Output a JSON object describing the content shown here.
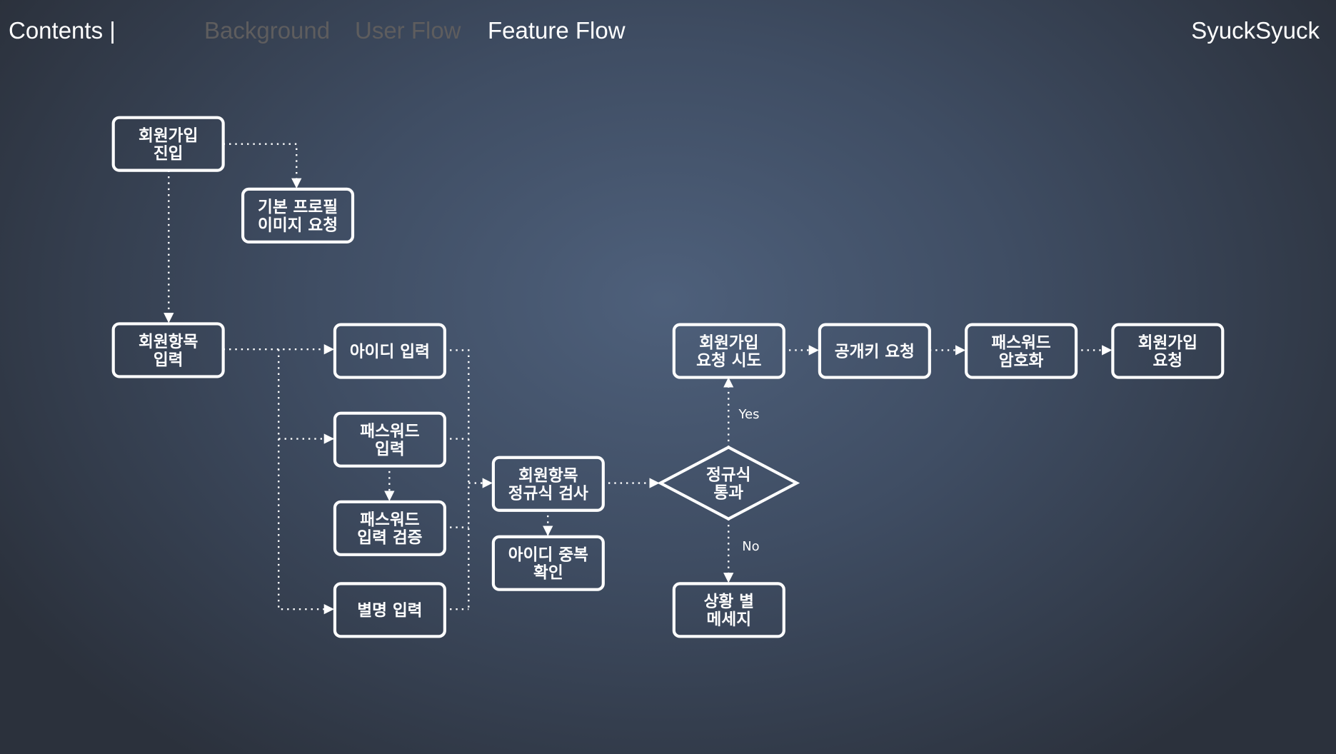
{
  "header": {
    "contents_label": "Contents |",
    "tabs": [
      {
        "label": "Background",
        "active": false
      },
      {
        "label": "User Flow",
        "active": false
      },
      {
        "label": "Feature Flow",
        "active": true
      }
    ],
    "brand": "SyuckSyuck"
  },
  "colors": {
    "inactive_tab": "#5e5d5e",
    "active_tab": "#ffffff",
    "line": "#ffffff"
  },
  "diagram": {
    "nodes": [
      {
        "id": "signup-entry",
        "lines": [
          "회원가입",
          "진입"
        ]
      },
      {
        "id": "default-profile",
        "lines": [
          "기본 프로필",
          "이미지 요청"
        ]
      },
      {
        "id": "member-input",
        "lines": [
          "회원항목",
          "입력"
        ]
      },
      {
        "id": "id-input",
        "lines": [
          "아이디 입력"
        ]
      },
      {
        "id": "password-input",
        "lines": [
          "패스워드",
          "입력"
        ]
      },
      {
        "id": "password-verify",
        "lines": [
          "패스워드",
          "입력 검증"
        ]
      },
      {
        "id": "nickname-input",
        "lines": [
          "별명 입력"
        ]
      },
      {
        "id": "regex-check",
        "lines": [
          "회원항목",
          "정규식 검사"
        ]
      },
      {
        "id": "id-duplicate",
        "lines": [
          "아이디 중복",
          "확인"
        ]
      },
      {
        "id": "regex-pass",
        "lines": [
          "정규식",
          "통과"
        ],
        "shape": "diamond"
      },
      {
        "id": "signup-attempt",
        "lines": [
          "회원가입",
          "요청 시도"
        ]
      },
      {
        "id": "public-key",
        "lines": [
          "공개키 요청"
        ]
      },
      {
        "id": "password-encrypt",
        "lines": [
          "패스워드",
          "암호화"
        ]
      },
      {
        "id": "signup-request",
        "lines": [
          "회원가입",
          "요청"
        ]
      },
      {
        "id": "situation-message",
        "lines": [
          "상황 별",
          "메세지"
        ]
      }
    ],
    "edge_labels": {
      "yes": "Yes",
      "no": "No"
    }
  }
}
